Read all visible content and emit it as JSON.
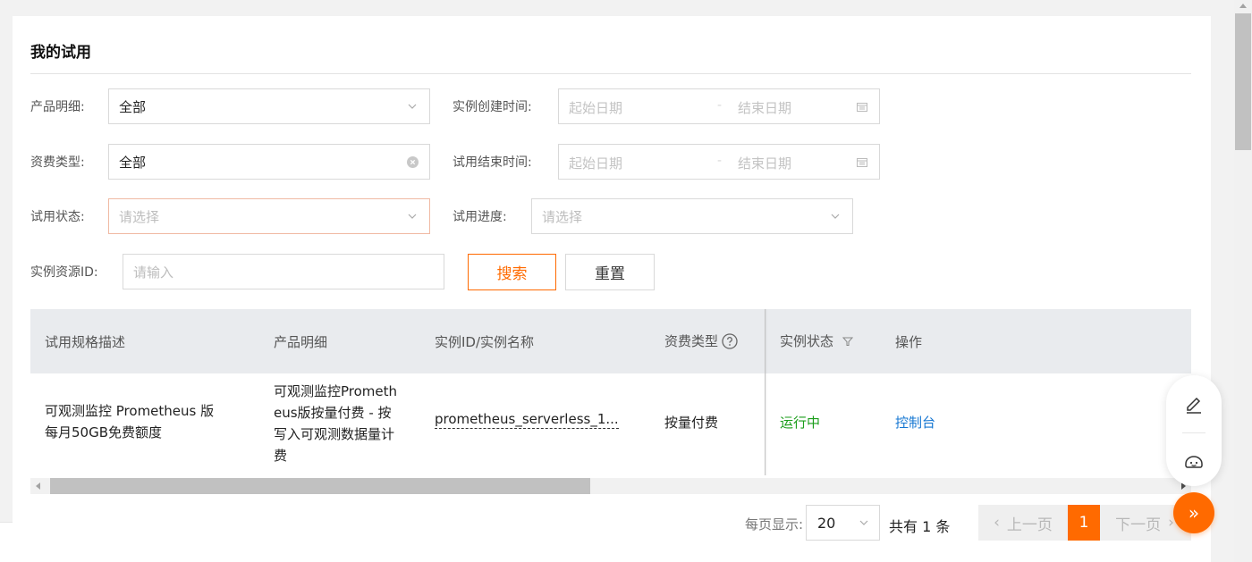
{
  "page": {
    "title": "我的试用"
  },
  "filters": {
    "product_detail": {
      "label": "产品明细:",
      "value": "全部"
    },
    "billing_type": {
      "label": "资费类型:",
      "value": "全部"
    },
    "trial_status": {
      "label": "试用状态:",
      "placeholder": "请选择"
    },
    "instance_resource_id": {
      "label": "实例资源ID:",
      "placeholder": "请输入"
    },
    "create_time": {
      "label": "实例创建时间:",
      "start_placeholder": "起始日期",
      "separator": "-",
      "end_placeholder": "结束日期"
    },
    "end_time": {
      "label": "试用结束时间:",
      "start_placeholder": "起始日期",
      "separator": "-",
      "end_placeholder": "结束日期"
    },
    "trial_progress": {
      "label": "试用进度:",
      "placeholder": "请选择"
    },
    "search_label": "搜索",
    "reset_label": "重置"
  },
  "table": {
    "columns": [
      "试用规格描述",
      "产品明细",
      "实例ID/实例名称",
      "资费类型",
      "实例状态",
      "操作"
    ],
    "rows": [
      {
        "spec_line1": "可观测监控 Prometheus 版",
        "spec_line2": "每月50GB免费额度",
        "product_line1": "可观测监控Prometh",
        "product_line2": "eus版按量付费 - 按",
        "product_line3": "写入可观测数据量计",
        "product_line4": "费",
        "instance": "prometheus_serverless_1...",
        "billing": "按量付费",
        "status": "运行中",
        "action": "控制台"
      }
    ]
  },
  "pagination": {
    "page_size_label": "每页显示:",
    "page_size": "20",
    "total_text": "共有 1 条",
    "prev_label": "上一页",
    "current_page": "1",
    "next_label": "下一页"
  },
  "floating": {
    "expand_symbol": "»"
  },
  "colors": {
    "accent": "#ff6a00",
    "status_running": "#1a9d1a",
    "link": "#1677d2"
  },
  "icons": [
    "chevron-down-icon",
    "clear-icon",
    "calendar-icon",
    "help-icon",
    "filter-icon",
    "edit-icon",
    "robot-icon",
    "double-arrow-icon"
  ]
}
